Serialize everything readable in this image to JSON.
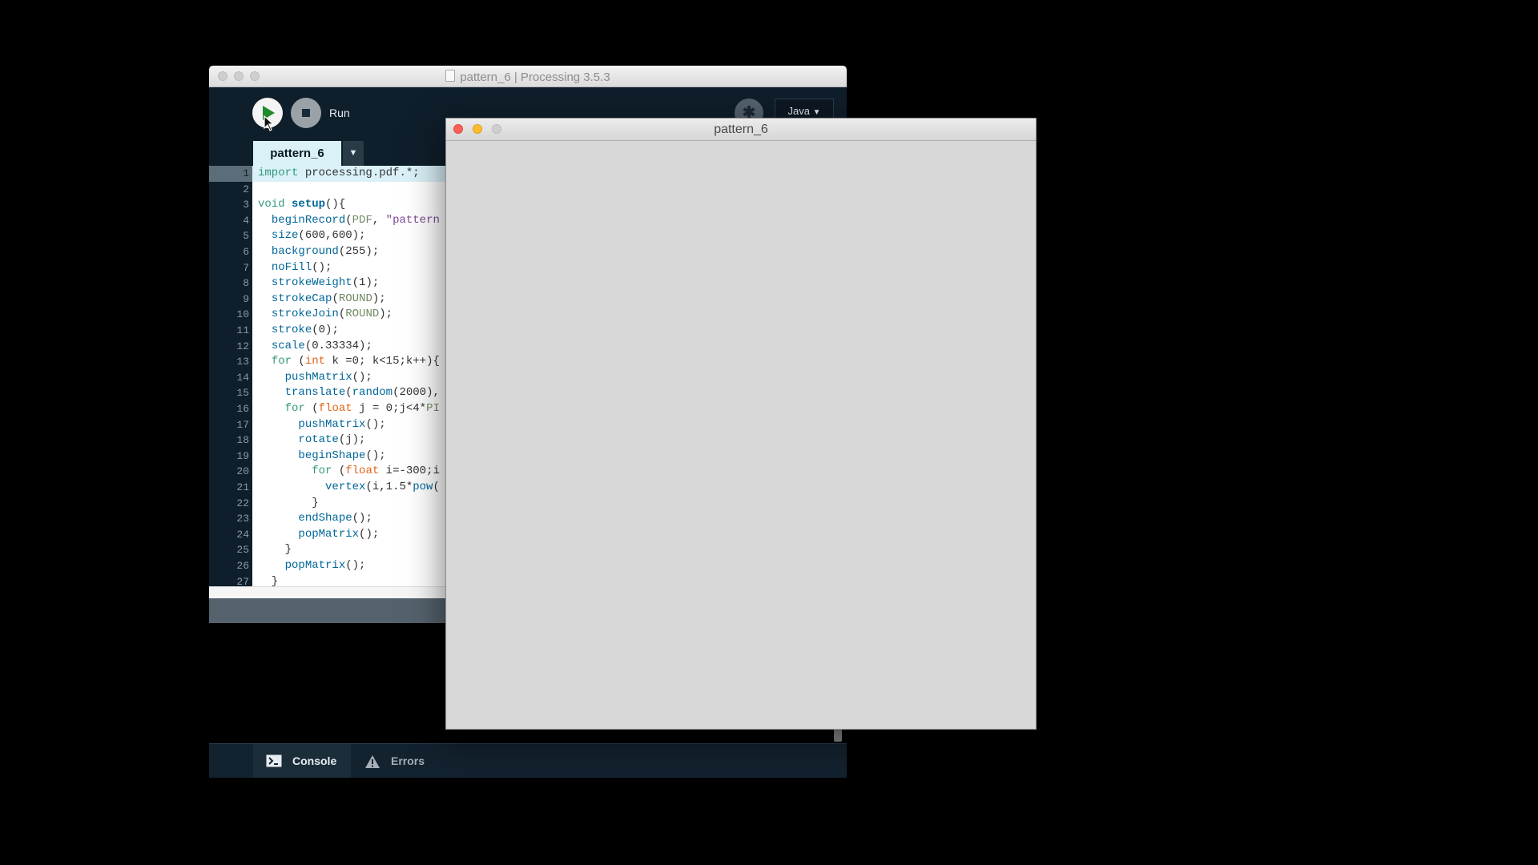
{
  "ide": {
    "title": "pattern_6 | Processing 3.5.3",
    "toolbar": {
      "run_label": "Run",
      "mode": "Java",
      "mode_arrow": "▼"
    },
    "tabs": {
      "active": "pattern_6",
      "menu": "▼"
    },
    "code_lines": [
      "import processing.pdf.*;",
      "",
      "void setup(){",
      "  beginRecord(PDF, \"pattern",
      "  size(600,600);",
      "  background(255);",
      "  noFill();",
      "  strokeWeight(1);",
      "  strokeCap(ROUND);",
      "  strokeJoin(ROUND);",
      "  stroke(0);",
      "  scale(0.33334);",
      "  for (int k =0; k<15;k++){",
      "    pushMatrix();",
      "    translate(random(2000),",
      "    for (float j = 0;j<4*PI",
      "      pushMatrix();",
      "      rotate(j);",
      "      beginShape();",
      "        for (float i=-300;i",
      "          vertex(i,1.5*pow(",
      "        }",
      "      endShape();",
      "      popMatrix();",
      "    }",
      "    popMatrix();",
      "  }"
    ],
    "line_numbers": [
      "1",
      "2",
      "3",
      "4",
      "5",
      "6",
      "7",
      "8",
      "9",
      "10",
      "11",
      "12",
      "13",
      "14",
      "15",
      "16",
      "17",
      "18",
      "19",
      "20",
      "21",
      "22",
      "23",
      "24",
      "25",
      "26",
      "27"
    ],
    "active_line": 1,
    "footer": {
      "console_label": "Console",
      "errors_label": "Errors"
    }
  },
  "sketch": {
    "title": "pattern_6"
  }
}
